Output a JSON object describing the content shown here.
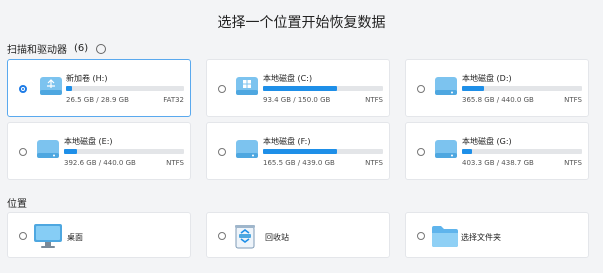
{
  "page": {
    "title": "选择一个位置开始恢复数据"
  },
  "drives_section": {
    "label": "扫描和驱动器",
    "count": "(6)",
    "info_icon": "info-icon"
  },
  "drives": [
    {
      "name": "新加卷 (H:)",
      "used_size": "26.5 GB / 28.9 GB",
      "fs": "FAT32",
      "usage": 0.05,
      "icon": "usb-drive-icon",
      "selected": true
    },
    {
      "name": "本地磁盘 (C:)",
      "used_size": "93.4 GB / 150.0 GB",
      "fs": "NTFS",
      "usage": 0.62,
      "icon": "windows-drive-icon",
      "selected": false
    },
    {
      "name": "本地磁盘 (D:)",
      "used_size": "365.8 GB / 440.0 GB",
      "fs": "NTFS",
      "usage": 0.18,
      "icon": "hard-drive-icon",
      "selected": false
    },
    {
      "name": "本地磁盘 (E:)",
      "used_size": "392.6 GB / 440.0 GB",
      "fs": "NTFS",
      "usage": 0.11,
      "icon": "hard-drive-icon",
      "selected": false
    },
    {
      "name": "本地磁盘 (F:)",
      "used_size": "165.5 GB / 439.0 GB",
      "fs": "NTFS",
      "usage": 0.62,
      "icon": "hard-drive-icon",
      "selected": false
    },
    {
      "name": "本地磁盘 (G:)",
      "used_size": "403.3 GB / 438.7 GB",
      "fs": "NTFS",
      "usage": 0.08,
      "icon": "hard-drive-icon",
      "selected": false
    }
  ],
  "locations_section": {
    "label": "位置"
  },
  "locations": [
    {
      "label": "桌面",
      "icon": "desktop-icon"
    },
    {
      "label": "回收站",
      "icon": "recycle-bin-icon"
    },
    {
      "label": "选择文件夹",
      "icon": "folder-icon"
    }
  ],
  "colors": {
    "accent": "#1e8fe8",
    "selected_border": "#5aa9ee",
    "card_bg": "#ffffff",
    "page_bg": "#f3f4f6"
  }
}
